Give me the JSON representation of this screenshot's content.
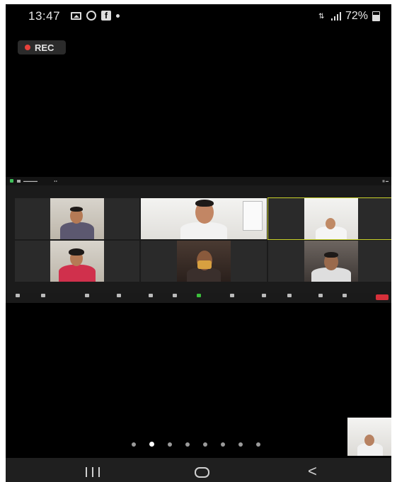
{
  "status_bar": {
    "time": "13:47",
    "battery": "72%"
  },
  "recording": {
    "label": "REC"
  },
  "meeting": {
    "participants_count": 6,
    "page_count": 8,
    "current_page": 2
  },
  "colors": {
    "rec_dot": "#e8413b",
    "active_speaker_border": "#c9d22a",
    "share_green": "#3cbf3c",
    "end_red": "#d6303a"
  },
  "icons": {
    "status": [
      "gallery-icon",
      "whatsapp-icon",
      "facebook-icon",
      "notification-dot-icon",
      "data-arrows-icon",
      "signal-icon",
      "battery-icon"
    ],
    "nav": [
      "recent-apps-icon",
      "home-icon",
      "back-icon"
    ]
  },
  "navigation": {
    "back_glyph": "<"
  }
}
